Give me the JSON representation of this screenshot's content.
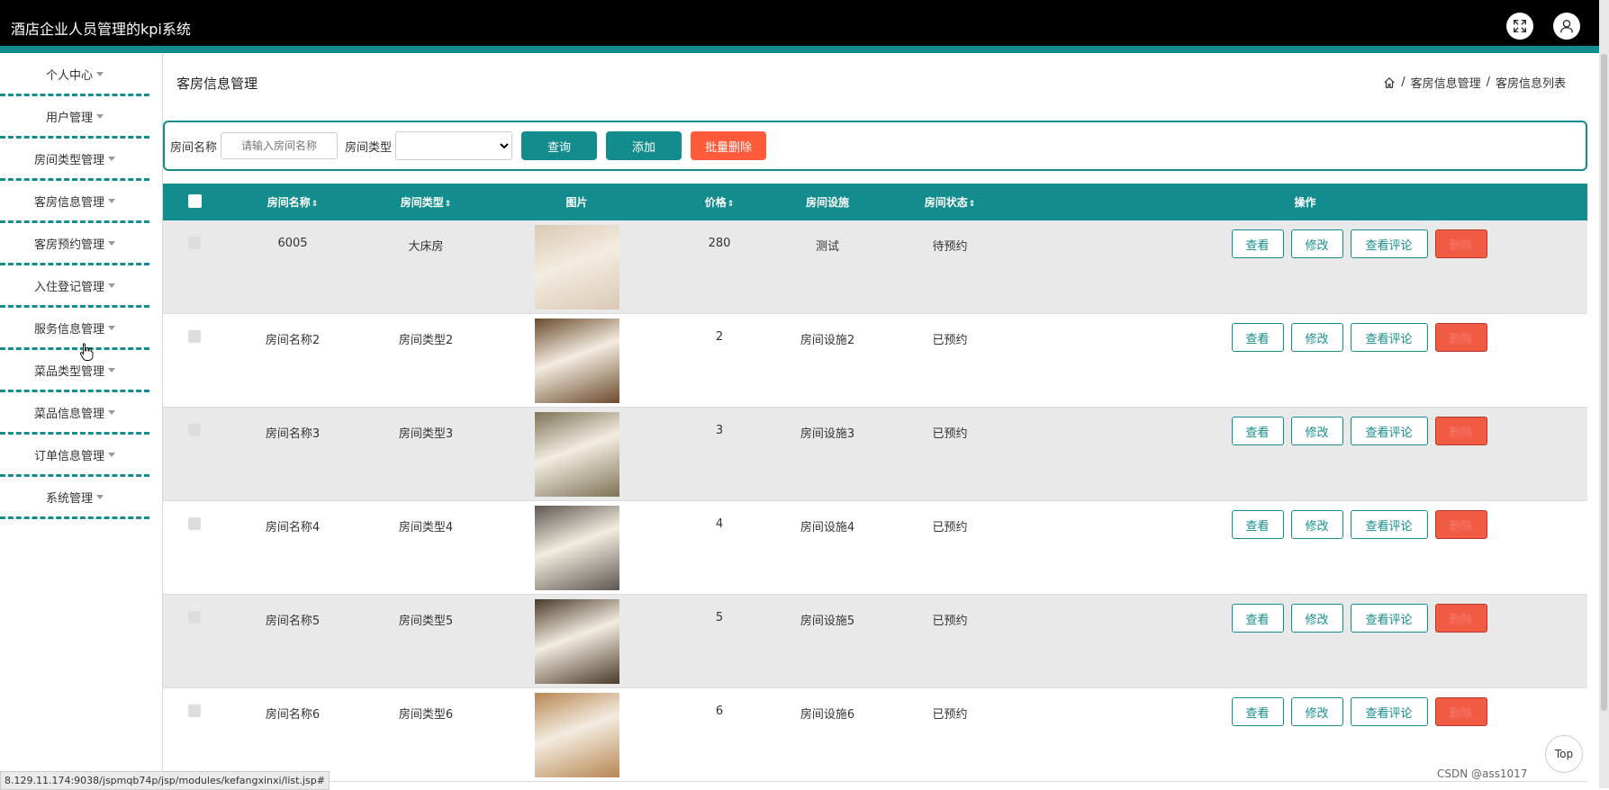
{
  "header": {
    "title": "酒店企业人员管理的kpi系统"
  },
  "sidebar": {
    "items": [
      {
        "label": "个人中心"
      },
      {
        "label": "用户管理"
      },
      {
        "label": "房间类型管理"
      },
      {
        "label": "客房信息管理"
      },
      {
        "label": "客房预约管理"
      },
      {
        "label": "入住登记管理"
      },
      {
        "label": "服务信息管理"
      },
      {
        "label": "菜品类型管理"
      },
      {
        "label": "菜品信息管理"
      },
      {
        "label": "订单信息管理"
      },
      {
        "label": "系统管理"
      }
    ]
  },
  "main": {
    "page_title": "客房信息管理",
    "breadcrumb": [
      "客房信息管理",
      "客房信息列表"
    ],
    "breadcrumb_sep": "/"
  },
  "search": {
    "name_label": "房间名称",
    "name_placeholder": "请输入房间名称",
    "type_label": "房间类型",
    "type_selected": "",
    "query_label": "查询",
    "add_label": "添加",
    "batch_delete_label": "批量删除"
  },
  "table": {
    "headers": {
      "name": "房间名称",
      "type": "房间类型",
      "image": "图片",
      "price": "价格",
      "facility": "房间设施",
      "status": "房间状态",
      "ops": "操作"
    },
    "sort_glyph": "⇕",
    "ops": {
      "view": "查看",
      "edit": "修改",
      "view_comments": "查看评论",
      "delete": "删除"
    },
    "rows": [
      {
        "name": "6005",
        "type": "大床房",
        "price": "280",
        "facility": "测试",
        "status": "待预约",
        "img_color": "#d9c9b4"
      },
      {
        "name": "房间名称2",
        "type": "房间类型2",
        "price": "2",
        "facility": "房间设施2",
        "status": "已预约",
        "img_color": "#6b4a2c"
      },
      {
        "name": "房间名称3",
        "type": "房间类型3",
        "price": "3",
        "facility": "房间设施3",
        "status": "已预约",
        "img_color": "#7d7357"
      },
      {
        "name": "房间名称4",
        "type": "房间类型4",
        "price": "4",
        "facility": "房间设施4",
        "status": "已预约",
        "img_color": "#5d5650"
      },
      {
        "name": "房间名称5",
        "type": "房间类型5",
        "price": "5",
        "facility": "房间设施5",
        "status": "已预约",
        "img_color": "#4a3b2a"
      },
      {
        "name": "房间名称6",
        "type": "房间类型6",
        "price": "6",
        "facility": "房间设施6",
        "status": "已预约",
        "img_color": "#b78652"
      }
    ]
  },
  "footer": {
    "top_label": "Top",
    "status_url": "8.129.11.174:9038/jspmqb74p/jsp/modules/kefangxinxi/list.jsp#",
    "watermark": "CSDN @ass1017"
  },
  "colors": {
    "accent": "#128c8c",
    "danger": "#f25b43"
  }
}
